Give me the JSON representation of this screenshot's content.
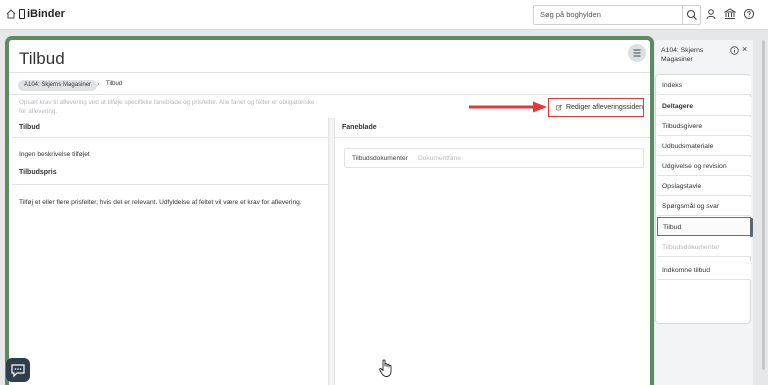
{
  "app": {
    "name": "iBinder"
  },
  "search": {
    "placeholder": "Søg på boghylden"
  },
  "page": {
    "title": "Tilbud",
    "breadcrumb": {
      "parent": "A104: Skjerns Magasiner",
      "separator": "›",
      "current": "Tilbud"
    },
    "intro": "Opsæt krav til aflevering ved at tilføje specifikke faneblade og prisfelter. Alle faner og felter er obligatoriske for aflevering.",
    "edit_button": "Rediger afleveringssiden"
  },
  "left": {
    "header": "Tilbud",
    "description": "Ingen beskrivelse tilføjet",
    "price_header": "Tilbudspris",
    "price_text": "Tilføj et eller flere prisfelter, hvis det er relevant. Udfyldelse af feltet vil være et krav for aflevering."
  },
  "right": {
    "header": "Faneblade",
    "tab_name": "Tilbudsdokumenter",
    "tab_type": "Dokumentfane"
  },
  "panel": {
    "title": "A104: Skjerns Magasiner",
    "close": "×",
    "items": [
      {
        "label": "Indeks"
      },
      {
        "label": "Deltagere"
      },
      {
        "label": "Tilbudsgivere"
      },
      {
        "label": "Udbudsmateriale"
      },
      {
        "label": "Udgivelse og revision"
      },
      {
        "label": "Opslagstavle"
      },
      {
        "label": "Spørgsmål og svar"
      },
      {
        "label": "Tilbud"
      },
      {
        "label": "Tilbudsdokumenter"
      },
      {
        "label": "Indkomne tilbud"
      }
    ]
  },
  "colors": {
    "frame": "#5e8a63",
    "highlight": "#e03b3b",
    "chat": "#2f3d4d"
  },
  "icons": [
    "home-icon",
    "search-icon",
    "user-icon",
    "bank-icon",
    "help-icon",
    "menu-icon",
    "edit-icon",
    "info-icon",
    "chat-icon",
    "hand-cursor-icon"
  ]
}
